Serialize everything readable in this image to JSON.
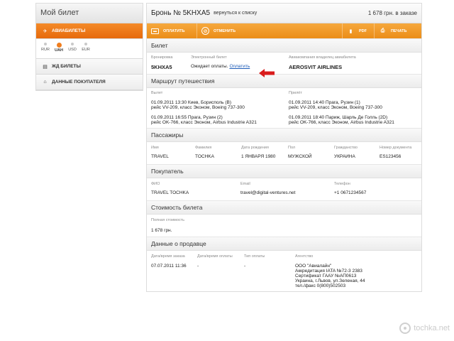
{
  "sidebar": {
    "title": "Мой билет",
    "items": [
      {
        "label": "АВИАБИЛЕТЫ",
        "icon": "airplane-icon"
      },
      {
        "label": "ЖД БИЛЕТЫ",
        "icon": "train-icon"
      },
      {
        "label": "ДАННЫЕ ПОКУПАТЕЛЯ",
        "icon": "home-icon"
      }
    ],
    "currencies": [
      "RUR",
      "UAH",
      "USD",
      "EUR"
    ],
    "selected_currency": "UAH"
  },
  "header": {
    "title": "Бронь № 5KHXA5",
    "back_link": "вернуться к списку",
    "price": "1 678 грн. в заказе"
  },
  "toolbar": {
    "pay": "ОПЛАТИТЬ",
    "cancel": "ОТМЕНИТЬ",
    "pdf": "PDF",
    "print": "ПЕЧАТЬ"
  },
  "ticket": {
    "title": "Билет",
    "booking_label": "Бронировка",
    "eticket_label": "Электронный билет",
    "carrier_label": "Авиакомпания владелец авиабилета",
    "booking_value": "5KHXA5",
    "status_text": "Ожидает оплаты.",
    "pay_link": "Оплатить",
    "carrier_value": "AEROSVIT AIRLINES"
  },
  "route": {
    "title": "Маршрут путешествия",
    "depart_label": "Вылет",
    "arrive_label": "Прилёт",
    "legs": [
      {
        "depart_line1": "01.09.2011 13:30 Киев, Борисполь (B)",
        "depart_line2": "рейс VV-209, класс Эконом, Boeing 737-300",
        "arrive_line1": "01.09.2011 14:40 Прага, Рузин (1)",
        "arrive_line2": "рейс VV-209, класс Эконом, Boeing 737-300"
      },
      {
        "depart_line1": "01.09.2011 16:55 Прага, Рузин (2)",
        "depart_line2": "рейс OK-766, класс Эконом, Airbus Industrie A321",
        "arrive_line1": "01.09.2011 18:40 Париж, Шарль Де Голль (2D)",
        "arrive_line2": "рейс OK-766, класс Эконом, Airbus Industrie A321"
      }
    ]
  },
  "passengers": {
    "title": "Пассажиры",
    "headers": [
      "Имя",
      "Фамилия",
      "Дата рождения",
      "Пол",
      "Гражданство",
      "Номер документа"
    ],
    "rows": [
      [
        "TRAVEL",
        "TOCHKA",
        "1 ЯНВАРЯ 1980",
        "МУЖСКОЙ",
        "УКРАИНА",
        "ES123456"
      ]
    ]
  },
  "buyer": {
    "title": "Покупатель",
    "fio_label": "ФИО",
    "email_label": "Email",
    "phone_label": "Телефон",
    "fio": "TRAVEL TOCHKA",
    "email": "travel@digital-ventures.net",
    "phone": "+1 0671234567"
  },
  "cost": {
    "title": "Стоимость билета",
    "full_label": "Полная стоимость",
    "full_value": "1 678 грн."
  },
  "seller": {
    "title": "Данные о продавце",
    "headers": [
      "Дата/время заказа",
      "Дата/время оплаты",
      "Тип оплаты",
      "Агентство"
    ],
    "order_dt": "07.07.2011 11:36",
    "pay_dt": "-",
    "pay_type": "-",
    "agency_lines": [
      "ООО \"Авиалайн\"",
      "Аккредитация IATA №72-3 2383",
      "Сертификат ГААУ №АП0613",
      "Украина, г.Львов, ул.Зеленая, 44",
      "тел./факс 0(800)502503"
    ]
  },
  "watermark": "tochka.net",
  "colors": {
    "accent": "#eb8d18",
    "active_tab": "#e66a0c",
    "link": "#1c5bb8",
    "arrow": "#d91c1c"
  }
}
